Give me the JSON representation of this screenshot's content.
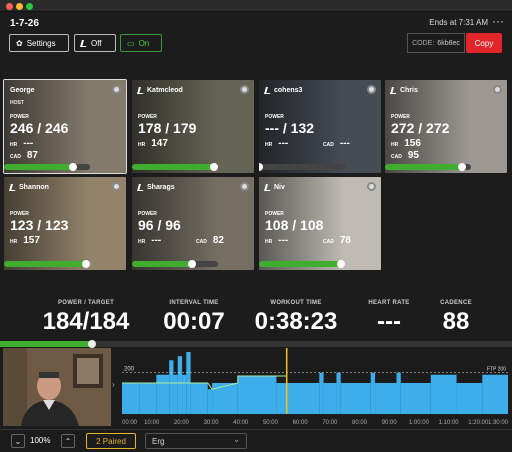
{
  "window": {
    "title": "1-7-26",
    "ends_at": "Ends at 7:31 AM",
    "more": "···"
  },
  "toolbar": {
    "settings_label": "Settings",
    "off_label": "Off",
    "on_label": "On",
    "code_label": "CODE:",
    "code_value": "6kb8ec",
    "copy_label": "Copy"
  },
  "tiles": [
    {
      "name": "George",
      "host_label": "HOST",
      "power_label": "POWER",
      "power": "246 / 246",
      "hr_label": "HR",
      "hr": "---",
      "cad_label": "CAD",
      "cad": "87",
      "progress": 0.8,
      "bg": "#8a8172"
    },
    {
      "name": "Katmcleod",
      "power_label": "POWER",
      "power": "178 / 179",
      "hr_label": "HR",
      "hr": "147",
      "cad_label": "",
      "cad": "",
      "progress": 0.95,
      "bg": "#6a6a5a"
    },
    {
      "name": "cohens3",
      "power_label": "POWER",
      "power": "--- / 132",
      "hr_label": "HR",
      "hr": "---",
      "cad_label": "CAD",
      "cad": "---",
      "progress": 0,
      "bg": "#4a5058"
    },
    {
      "name": "Chris",
      "power_label": "POWER",
      "power": "272 / 272",
      "hr_label": "HR",
      "hr": "156",
      "cad_label": "CAD",
      "cad": "95",
      "progress": 0.9,
      "bg": "#a5a09a"
    },
    {
      "name": "Shannon",
      "power_label": "POWER",
      "power": "123 / 123",
      "hr_label": "HR",
      "hr": "157",
      "cad_label": "",
      "cad": "",
      "progress": 0.95,
      "bg": "#9a8a70"
    },
    {
      "name": "Sharags",
      "power_label": "POWER",
      "power": "96 / 96",
      "hr_label": "HR",
      "hr": "---",
      "cad_label": "CAD",
      "cad": "82",
      "progress": 0.7,
      "bg": "#7a7468"
    },
    {
      "name": "Niv",
      "power_label": "POWER",
      "power": "108 / 108",
      "hr_label": "HR",
      "hr": "---",
      "cad_label": "CAD",
      "cad": "78",
      "progress": 0.95,
      "bg": "#c9c5bd"
    }
  ],
  "metrics": [
    {
      "label": "POWER / TARGET",
      "value": "184/184"
    },
    {
      "label": "INTERVAL TIME",
      "value": "00:07"
    },
    {
      "label": "WORKOUT TIME",
      "value": "0:38:23"
    },
    {
      "label": "HEART RATE",
      "value": "---"
    },
    {
      "label": "CADENCE",
      "value": "88"
    }
  ],
  "power_progress": 0.18,
  "chart_data": {
    "type": "area",
    "title": "",
    "xlabel": "",
    "ylabel": "",
    "ftp_label": "FTP 200",
    "y_tick": "200",
    "ylim": [
      0,
      300
    ],
    "xlim": [
      0,
      90
    ],
    "x_ticks": [
      "00:00",
      "10:00",
      "20:00",
      "30:00",
      "40:00",
      "50:00",
      "60:00",
      "70:00",
      "80:00",
      "90:00",
      "1:00:00",
      "1:10:00",
      "1:20:00",
      "1:30:00"
    ],
    "current_time": 38.4,
    "segments": [
      {
        "start": 0,
        "end": 4,
        "power": 150
      },
      {
        "start": 4,
        "end": 8,
        "power": 150
      },
      {
        "start": 8,
        "end": 11,
        "power": 190
      },
      {
        "start": 11,
        "end": 12,
        "power": 260
      },
      {
        "start": 12,
        "end": 13,
        "power": 190
      },
      {
        "start": 13,
        "end": 14,
        "power": 280
      },
      {
        "start": 14,
        "end": 15,
        "power": 190
      },
      {
        "start": 15,
        "end": 16,
        "power": 300
      },
      {
        "start": 16,
        "end": 20,
        "power": 150
      },
      {
        "start": 20,
        "end": 21,
        "power": 120
      },
      {
        "start": 21,
        "end": 27,
        "power": 150
      },
      {
        "start": 27,
        "end": 36,
        "power": 184
      },
      {
        "start": 36,
        "end": 38,
        "power": 150
      },
      {
        "start": 38,
        "end": 46,
        "power": 150
      },
      {
        "start": 46,
        "end": 47,
        "power": 200
      },
      {
        "start": 47,
        "end": 50,
        "power": 150
      },
      {
        "start": 50,
        "end": 51,
        "power": 200
      },
      {
        "start": 51,
        "end": 58,
        "power": 150
      },
      {
        "start": 58,
        "end": 59,
        "power": 200
      },
      {
        "start": 59,
        "end": 64,
        "power": 150
      },
      {
        "start": 64,
        "end": 65,
        "power": 200
      },
      {
        "start": 65,
        "end": 72,
        "power": 150
      },
      {
        "start": 72,
        "end": 78,
        "power": 190
      },
      {
        "start": 78,
        "end": 84,
        "power": 150
      },
      {
        "start": 84,
        "end": 90,
        "power": 190
      }
    ],
    "colors": {
      "bar": "#3daee9",
      "now": "#f0c419",
      "actual": "#a8f0a0"
    }
  },
  "footer": {
    "zoom_down": "⌄",
    "zoom": "100%",
    "zoom_up": "⌃",
    "paired": "2 Paired",
    "mode": "Erg",
    "mode_chevron": "⌄"
  }
}
